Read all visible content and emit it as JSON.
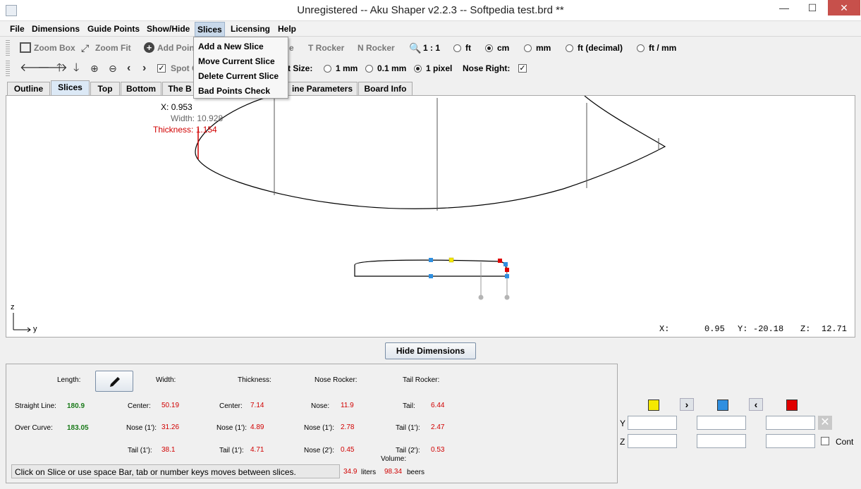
{
  "window": {
    "title": "Unregistered -- Aku Shaper v2.2.3  --  Softpedia test.brd  **",
    "minimize": "—",
    "maximize": "☐",
    "close": "✕"
  },
  "menu": {
    "items": [
      "File",
      "Dimensions",
      "Guide Points",
      "Show/Hide",
      "Slices",
      "Licensing",
      "Help"
    ],
    "active": "Slices",
    "dropdown": [
      "Add a New Slice",
      "Move Current Slice",
      "Delete Current Slice",
      "Bad Points Check"
    ]
  },
  "toolbar1": {
    "zoom_box": "Zoom Box",
    "zoom_fit": "Zoom Fit",
    "add_point": "Add Poin",
    "partial_e": "e",
    "t_rocker": "T Rocker",
    "n_rocker": "N Rocker",
    "scale": "1 : 1",
    "units": [
      {
        "label": "ft",
        "selected": false
      },
      {
        "label": "cm",
        "selected": true
      },
      {
        "label": "mm",
        "selected": false
      },
      {
        "label": "ft (decimal)",
        "selected": false
      },
      {
        "label": "ft / mm",
        "selected": false
      }
    ]
  },
  "toolbar2": {
    "spot_check": "Spot C",
    "step_size_label": "t Size:",
    "steps": [
      {
        "label": "1 mm",
        "selected": false
      },
      {
        "label": "0.1 mm",
        "selected": false
      },
      {
        "label": "1 pixel",
        "selected": true
      }
    ],
    "nose_right_label": "Nose Right:",
    "nose_right_checked": "✓"
  },
  "tabs": [
    "Outline",
    "Slices",
    "Top",
    "Bottom",
    "The B",
    "ine Parameters",
    "Board Info"
  ],
  "active_tab": "Slices",
  "canvas": {
    "cursor_x_label": "X:",
    "cursor_x_value": "0.953",
    "width_label": "Width:",
    "width_value": "10.928",
    "thickness_label": "Thickness:",
    "thickness_value": "1.154",
    "axis_z": "z",
    "axis_y": "y",
    "readout": {
      "x_label": "X:",
      "x_value": "0.95",
      "y_label": "Y:",
      "y_value": "-20.18",
      "z_label": "Z:",
      "z_value": "12.71"
    },
    "marker_colors": {
      "yellow": "#f5e900",
      "blue": "#2f8fe0",
      "red": "#e00000",
      "gray": "#b4b4b4"
    }
  },
  "hide_dimensions": "Hide Dimensions",
  "dimensions": {
    "length_label": "Length:",
    "width_label": "Width:",
    "thickness_label": "Thickness:",
    "nose_rocker_label": "Nose Rocker:",
    "tail_rocker_label": "Tail Rocker:",
    "straight_line_label": "Straight Line:",
    "straight_line_value": "180.9",
    "over_curve_label": "Over Curve:",
    "over_curve_value": "183.05",
    "width_center_label": "Center:",
    "width_center": "50.19",
    "width_nose1_label": "Nose (1'):",
    "width_nose1": "31.26",
    "width_tail1_label": "Tail (1'):",
    "width_tail1": "38.1",
    "thick_center_label": "Center:",
    "thick_center": "7.14",
    "thick_nose1_label": "Nose (1'):",
    "thick_nose1": "4.89",
    "thick_tail1_label": "Tail (1'):",
    "thick_tail1": "4.71",
    "nr_nose_label": "Nose:",
    "nr_nose": "11.9",
    "nr_nose1_label": "Nose (1'):",
    "nr_nose1": "2.78",
    "nr_nose2_label": "Nose (2'):",
    "nr_nose2": "0.45",
    "tr_tail_label": "Tail:",
    "tr_tail": "6.44",
    "tr_tail1_label": "Tail (1'):",
    "tr_tail1": "2.47",
    "tr_tail2_label": "Tail (2'):",
    "tr_tail2": "0.53",
    "volume_label": "Volume:",
    "volume_liters": "34.9",
    "liters_label": "liters",
    "volume_beers": "98.34",
    "beers_label": "beers"
  },
  "status": "Click on Slice or use space Bar, tab or number keys moves between slices.",
  "right_panel": {
    "y_label": "Y",
    "z_label": "Z",
    "cont_label": "Cont"
  }
}
